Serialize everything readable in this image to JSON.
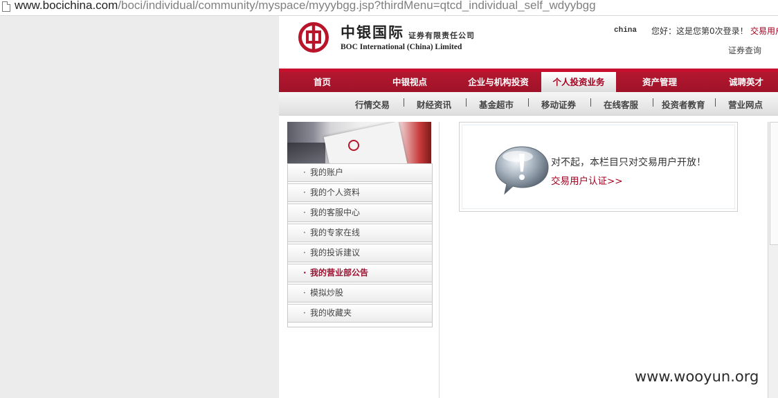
{
  "address_bar": {
    "host": "www.bocichina.com",
    "path": "/boci/individual/community/myspace/myyybgg.jsp?thirdMenu=qtcd_individual_self_wdyybgg",
    "icon": "page-icon"
  },
  "header": {
    "logo_icon": "boc-logo-icon",
    "brand_cn": "中银国际",
    "brand_cn_sub": "证券有限责任公司",
    "brand_en": "BOC International (China) Limited",
    "lang": "china",
    "greeting": "您好：这是您第0次登录！",
    "trade_user": "交易用户",
    "securities_query": "证券查询"
  },
  "nav_main": [
    "首页",
    "中银视点",
    "企业与机构投资",
    "个人投资业务",
    "资产管理",
    "诚聘英才"
  ],
  "nav_main_active": "个人投资业务",
  "nav_sub": [
    "行情交易",
    "财经资讯",
    "基金超市",
    "移动证券",
    "在线客服",
    "投资者教育",
    "营业网点"
  ],
  "sidebar": {
    "items": [
      "我的账户",
      "我的个人资料",
      "我的客服中心",
      "我的专家在线",
      "我的投诉建议",
      "我的营业部公告",
      "模拟炒股",
      "我的收藏夹"
    ],
    "active": "我的营业部公告"
  },
  "notice": {
    "icon": "info-bubble-icon",
    "message": "对不起，本栏目只对交易用户开放！",
    "link": "交易用户认证>>"
  },
  "watermark": "www.wooyun.org",
  "colors": {
    "brand_red": "#c8102e",
    "link_red": "#a3001f",
    "page_bg": "#ececec"
  }
}
